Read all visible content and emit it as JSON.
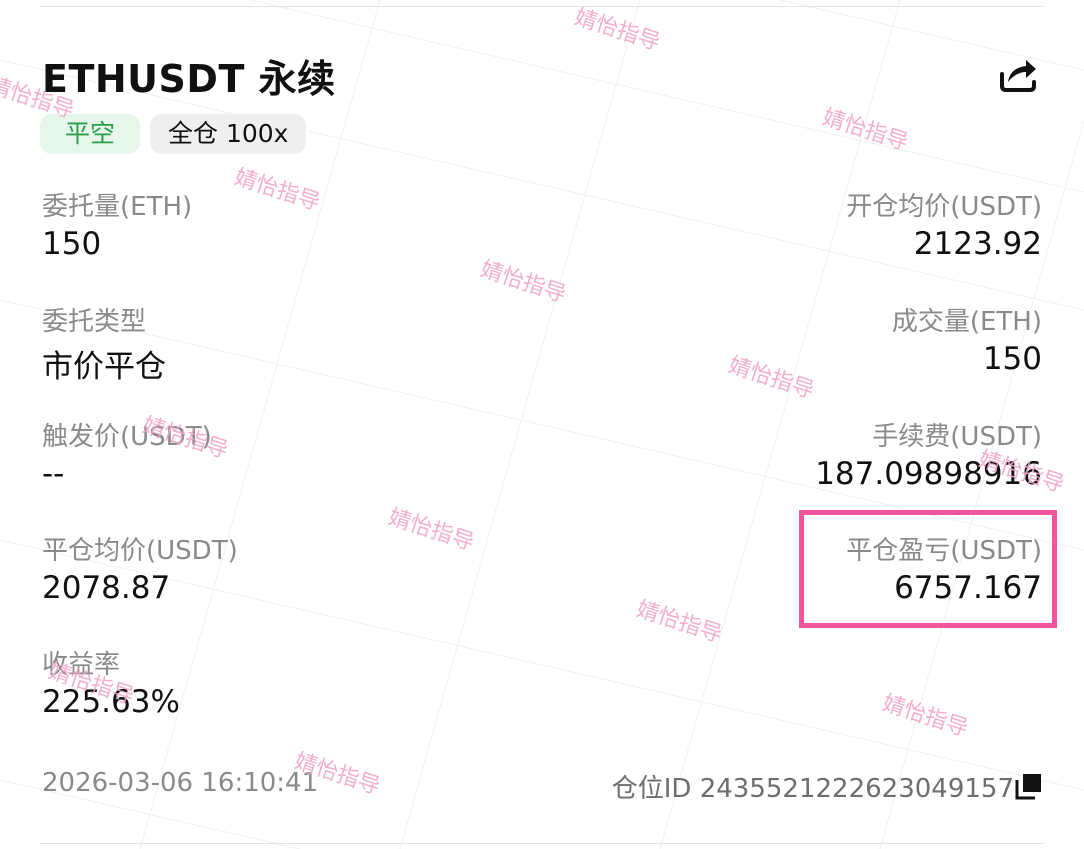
{
  "header": {
    "title": "ETHUSDT 永续",
    "share_icon": "share-icon"
  },
  "tags": {
    "side": "平空",
    "margin": "全仓 100x",
    "side_color": "#2c9e49",
    "side_bg": "#e6f6ea"
  },
  "fields": {
    "order_qty_label": "委托量(ETH)",
    "order_qty_value": "150",
    "open_avg_label": "开仓均价(USDT)",
    "open_avg_value": "2123.92",
    "order_type_label": "委托类型",
    "order_type_value": "市价平仓",
    "filled_qty_label": "成交量(ETH)",
    "filled_qty_value": "150",
    "trigger_label": "触发价(USDT)",
    "trigger_value": "--",
    "fee_label": "手续费(USDT)",
    "fee_value": "187.09898916",
    "close_avg_label": "平仓均价(USDT)",
    "close_avg_value": "2078.87",
    "pnl_label": "平仓盈亏(USDT)",
    "pnl_value": "6757.167",
    "roi_label": "收益率",
    "roi_value": "225.63%"
  },
  "footer": {
    "timestamp": "2026-03-06 16:10:41",
    "position_id": "仓位ID 2435521222623049157",
    "copy_icon": "copy-icon"
  },
  "watermark": {
    "text": "婧怡指导",
    "color": "#f3a6c8"
  },
  "highlight_color": "#f2559c"
}
